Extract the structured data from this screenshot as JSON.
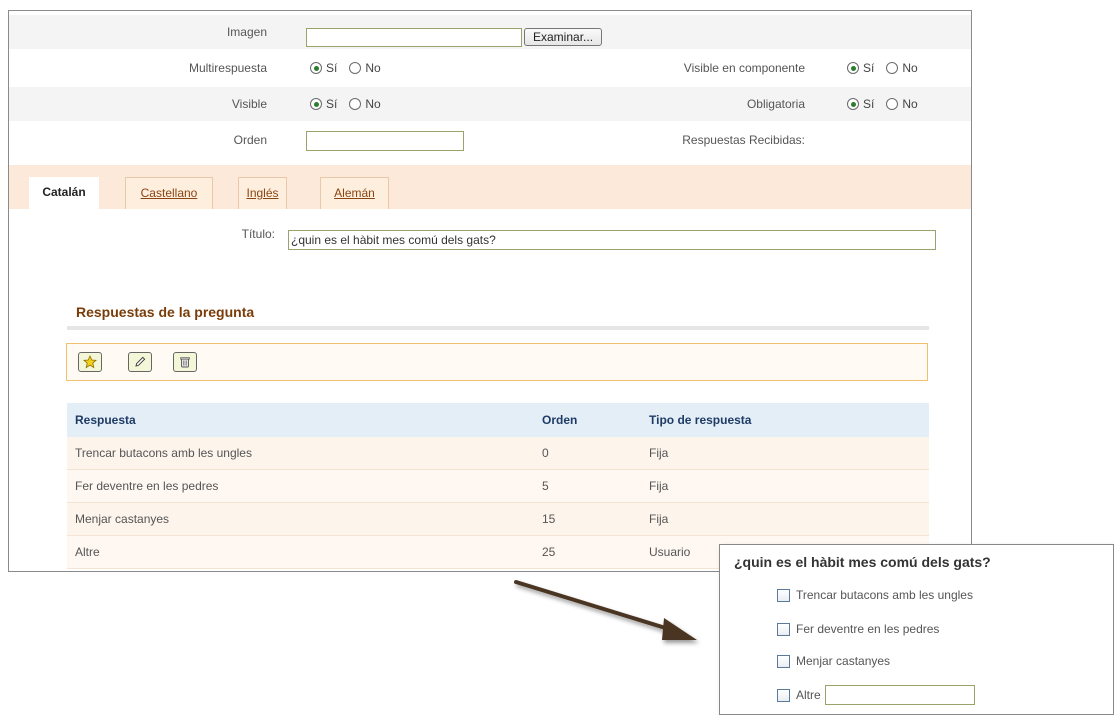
{
  "form": {
    "imagen": {
      "label": "Imagen",
      "value": "",
      "button": "Examinar..."
    },
    "multirespuesta": {
      "label": "Multirespuesta",
      "yes": "Sí",
      "no": "No",
      "selected": "yes"
    },
    "visible_componente": {
      "label": "Visible en componente",
      "yes": "Sí",
      "no": "No",
      "selected": "yes"
    },
    "visible": {
      "label": "Visible",
      "yes": "Sí",
      "no": "No",
      "selected": "yes"
    },
    "obligatoria": {
      "label": "Obligatoria",
      "yes": "Sí",
      "no": "No",
      "selected": "yes"
    },
    "orden": {
      "label": "Orden",
      "value": ""
    },
    "respuestas_recibidas": {
      "label": "Respuestas Recibidas:"
    }
  },
  "tabs": [
    {
      "label": "Catalán",
      "active": true
    },
    {
      "label": "Castellano",
      "active": false
    },
    {
      "label": "Inglés",
      "active": false
    },
    {
      "label": "Alemán",
      "active": false
    }
  ],
  "titulo": {
    "label": "Título:",
    "value": "¿quin es el hàbit mes comú dels gats?"
  },
  "respuestas": {
    "section_title": "Respuestas de la pregunta",
    "toolbar_icons": [
      "star-icon",
      "pencil-icon",
      "trash-icon"
    ],
    "columns": [
      "Respuesta",
      "Orden",
      "Tipo de respuesta"
    ],
    "rows": [
      [
        "Trencar butacons amb les ungles",
        "0",
        "Fija"
      ],
      [
        "Fer deventre en les pedres",
        "5",
        "Fija"
      ],
      [
        "Menjar castanyes",
        "15",
        "Fija"
      ],
      [
        "Altre",
        "25",
        "Usuario"
      ]
    ]
  },
  "preview": {
    "title": "¿quin es el hàbit mes comú dels gats?",
    "options": [
      "Trencar butacons amb les ungles",
      "Fer deventre en les pedres",
      "Menjar castanyes",
      "Altre"
    ]
  },
  "colors": {
    "tab_bar": "#fde9d9",
    "header_row": "#e4eef7",
    "section_title": "#7a3d0a",
    "radio_selected": "#2a7d2a"
  }
}
